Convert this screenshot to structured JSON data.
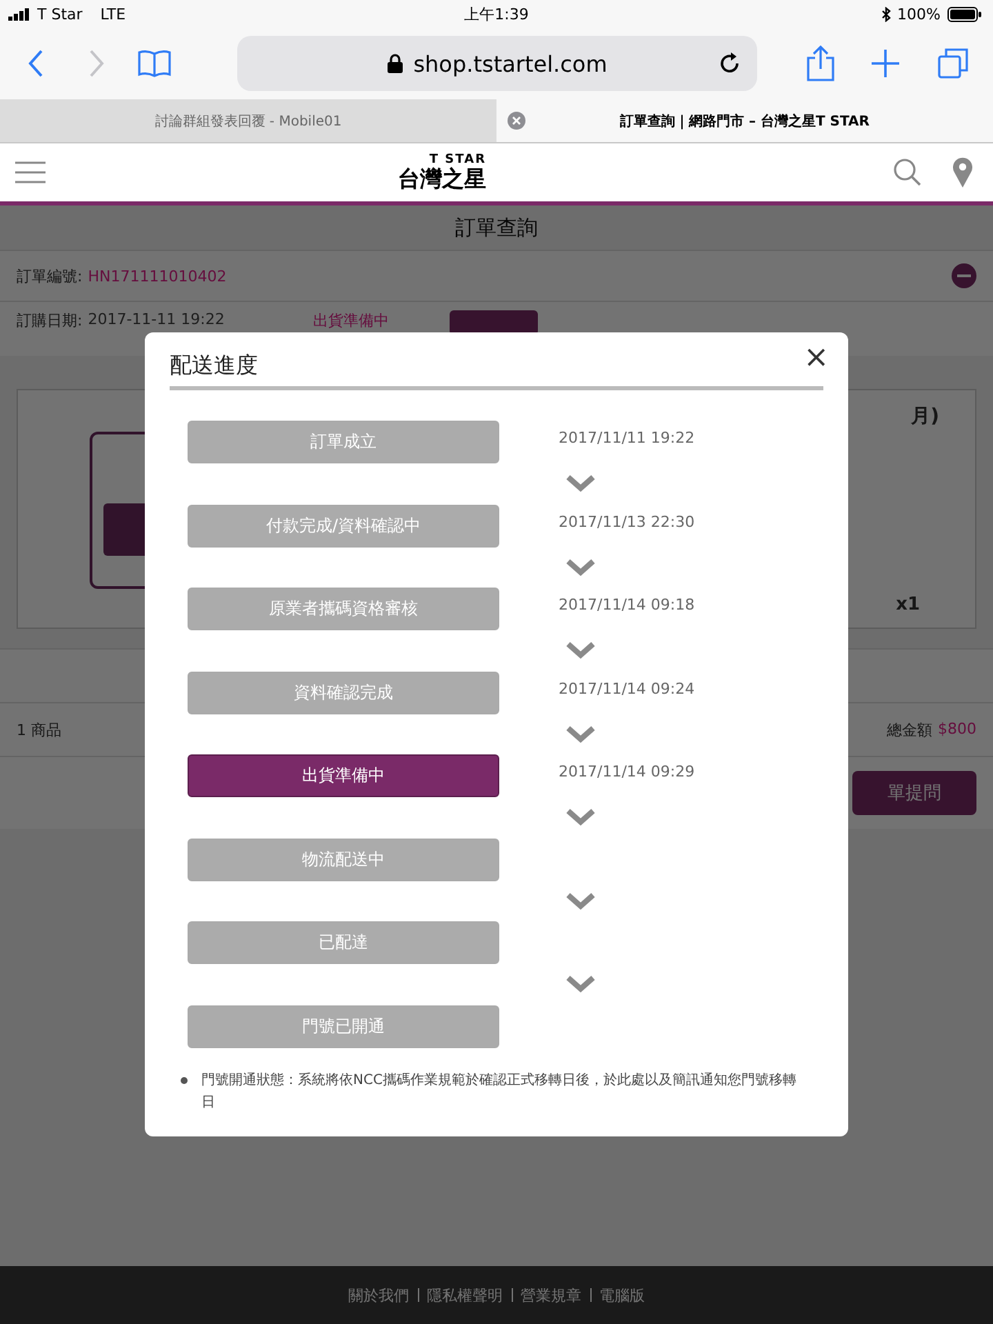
{
  "status_bar": {
    "carrier": "T Star",
    "network": "LTE",
    "time": "上午1:39",
    "battery": "100%"
  },
  "browser": {
    "url": "shop.tstartel.com",
    "tabs": [
      {
        "title": "討論群組發表回覆 - Mobile01",
        "selected": false
      },
      {
        "title": "訂單查詢｜網路門市 – 台灣之星T STAR",
        "selected": true
      }
    ]
  },
  "site_header": {
    "logo_top": "T STAR",
    "logo_main": "台灣之星"
  },
  "page": {
    "title": "訂單查詢",
    "order_label": "訂單編號:",
    "order_number": "HN171111010402",
    "date_label": "訂購日期:",
    "date": "2017-11-11 19:22",
    "status": "出貨準備中",
    "product_fragment": "月)",
    "quantity": "x1",
    "items": "1 商品",
    "total_label": "總金額",
    "total": "$800",
    "ask_button": "單提問"
  },
  "modal": {
    "title": "配送進度",
    "close": "×",
    "steps": [
      {
        "label": "訂單成立",
        "time": "2017/11/11 19:22",
        "selected": false
      },
      {
        "label": "付款完成/資料確認中",
        "time": "2017/11/13 22:30",
        "selected": false
      },
      {
        "label": "原業者攜碼資格審核",
        "time": "2017/11/14 09:18",
        "selected": false
      },
      {
        "label": "資料確認完成",
        "time": "2017/11/14 09:24",
        "selected": false
      },
      {
        "label": "出貨準備中",
        "time": "2017/11/14 09:29",
        "selected": true
      },
      {
        "label": "物流配送中",
        "selected": false
      },
      {
        "label": "已配達",
        "selected": false
      },
      {
        "label": "門號已開通",
        "selected": false
      }
    ],
    "note": "門號開通狀態：系統將依NCC攜碼作業規範於確認正式移轉日後，於此處以及簡訊通知您門號移轉日"
  },
  "footer": {
    "links": [
      "關於我們",
      "隱私權聲明",
      "營業規章",
      "電腦版"
    ]
  }
}
